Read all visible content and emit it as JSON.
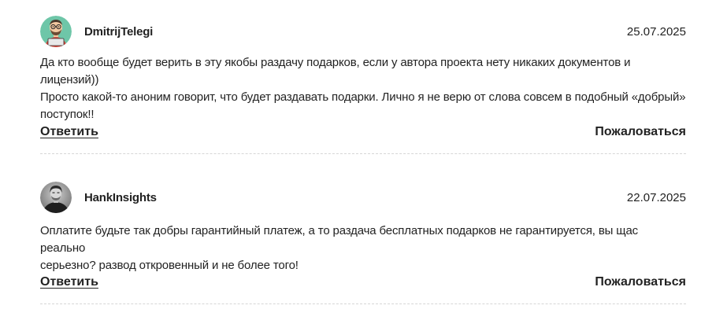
{
  "comments": [
    {
      "author": "DmitrijTelegi",
      "date": "25.07.2025",
      "avatar_icon": "cartoon-man-avatar-icon",
      "avatar_bg": "#6ec6a8",
      "text_lines": [
        "Да кто вообще будет верить в эту якобы раздачу подарков, если у автора проекта нету никаких документов и лицензий))",
        "Просто какой-то аноним говорит, что будет раздавать подарки. Лично я не верю от слова совсем в подобный «добрый»",
        "поступок!!"
      ],
      "reply_label": "Ответить",
      "report_label": "Пожаловаться"
    },
    {
      "author": "HankInsights",
      "date": "22.07.2025",
      "avatar_icon": "bw-portrait-avatar-icon",
      "avatar_bg": "#9a9a9a",
      "text_lines": [
        "Оплатите будьте так добры гарантийный платеж, а то раздача бесплатных подарков не гарантируется, вы щас реально",
        "серьезно? развод откровенный и не более того!"
      ],
      "reply_label": "Ответить",
      "report_label": "Пожаловаться"
    }
  ],
  "colors": {
    "text": "#222222",
    "divider": "#d6d6d6",
    "background": "#ffffff"
  }
}
